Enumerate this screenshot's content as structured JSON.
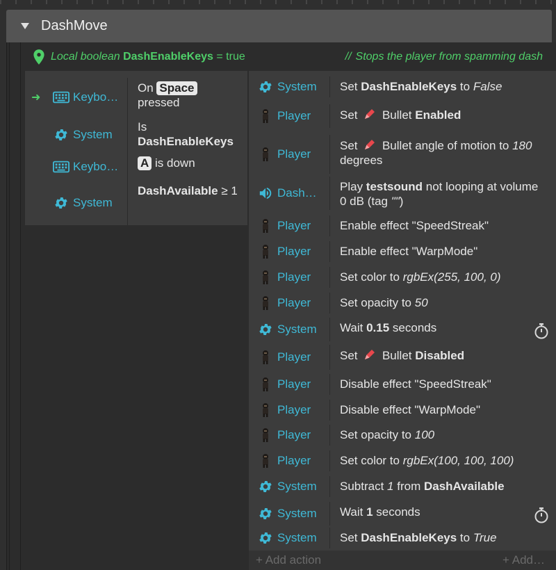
{
  "group": {
    "title": "DashMove",
    "expand_icon": "triangle-down-icon"
  },
  "local_var": {
    "icon": "map-pin-icon",
    "prefix": "Local boolean",
    "name": "DashEnableKeys",
    "suffix": "= true",
    "comment_marker": "//",
    "comment": "Stops the player from spamming dash",
    "color": "#4fcf69"
  },
  "conditions": [
    {
      "icon": "keyboard-icon",
      "object": "Keybo…",
      "has_arrow": true,
      "pre": "On",
      "key": "Space",
      "post": "pressed"
    },
    {
      "icon": "gear-icon",
      "object": "System",
      "pre": "Is",
      "bold": "DashEnableKeys"
    },
    {
      "icon": "keyboard-icon",
      "object": "Keybo…",
      "key": "A",
      "post": "is down"
    },
    {
      "icon": "gear-icon",
      "object": "System",
      "bold": "DashAvailable",
      "post": "≥ 1"
    }
  ],
  "actions": [
    {
      "icon": "gear-icon",
      "object": "System",
      "text": "Set <b>DashEnableKeys</b> to <i>False</i>"
    },
    {
      "icon": "player-sprite-icon",
      "object": "Player",
      "text": "Set <span class='pencil'></span> Bullet <b>Enabled</b>"
    },
    {
      "icon": "player-sprite-icon",
      "object": "Player",
      "text": "Set <span class='pencil'></span> Bullet angle of motion to <i>180</i> degrees"
    },
    {
      "icon": "speaker-icon",
      "object": "Dash…",
      "text": "Play <b>testsound</b> not looping at volume 0 dB (tag <i>\"\"</i>)"
    },
    {
      "icon": "player-sprite-icon",
      "object": "Player",
      "text": "Enable effect \"SpeedStreak\""
    },
    {
      "icon": "player-sprite-icon",
      "object": "Player",
      "text": "Enable effect \"WarpMode\""
    },
    {
      "icon": "player-sprite-icon",
      "object": "Player",
      "text": "Set color to <i>rgbEx(255, 100, 0)</i>"
    },
    {
      "icon": "player-sprite-icon",
      "object": "Player",
      "text": "Set opacity to <i>50</i>"
    },
    {
      "icon": "gear-icon",
      "object": "System",
      "text": "Wait <b>0.15</b> seconds",
      "timer": true
    },
    {
      "icon": "player-sprite-icon",
      "object": "Player",
      "text": "Set <span class='pencil'></span> Bullet <b>Disabled</b>"
    },
    {
      "icon": "player-sprite-icon",
      "object": "Player",
      "text": "Disable effect \"SpeedStreak\""
    },
    {
      "icon": "player-sprite-icon",
      "object": "Player",
      "text": "Disable effect \"WarpMode\""
    },
    {
      "icon": "player-sprite-icon",
      "object": "Player",
      "text": "Set opacity to <i>100</i>"
    },
    {
      "icon": "player-sprite-icon",
      "object": "Player",
      "text": "Set color to <i>rgbEx(100, 100, 100)</i>"
    },
    {
      "icon": "gear-icon",
      "object": "System",
      "text": "Subtract <i>1</i> from <b>DashAvailable</b>"
    },
    {
      "icon": "gear-icon",
      "object": "System",
      "text": "Wait <b>1</b> seconds",
      "timer": true
    },
    {
      "icon": "gear-icon",
      "object": "System",
      "text": "Set <b>DashEnableKeys</b> to <i>True</i>"
    }
  ],
  "add_action": {
    "left": "+ Add action",
    "right": "+ Add…"
  },
  "colors": {
    "object_label": "#3fb9d6",
    "accent_green": "#4fcf69",
    "panel": "#3c3c3c",
    "header": "#545454"
  }
}
